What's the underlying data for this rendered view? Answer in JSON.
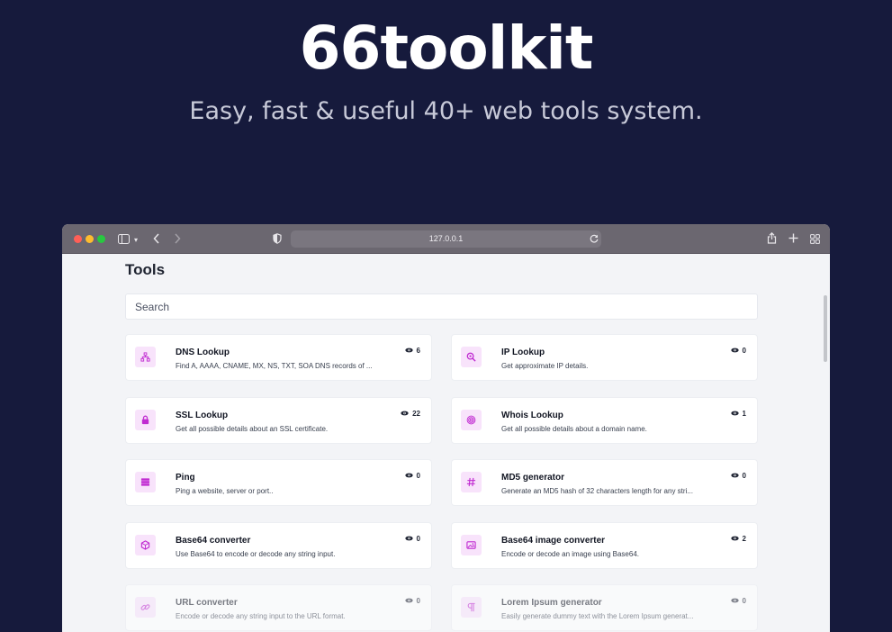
{
  "hero": {
    "title": "66toolkit",
    "subtitle": "Easy, fast & useful 40+ web tools system."
  },
  "browser": {
    "address": "127.0.0.1"
  },
  "page": {
    "title": "Tools",
    "search_placeholder": "Search"
  },
  "colors": {
    "background": "#161a3c",
    "accent": "#c02ad1",
    "icon_bg": "#f8e3fb"
  },
  "tools": [
    {
      "name": "DNS Lookup",
      "description": "Find A, AAAA, CNAME, MX, NS, TXT, SOA DNS records of ...",
      "views": "6",
      "icon": "network-icon"
    },
    {
      "name": "IP Lookup",
      "description": "Get approximate IP details.",
      "views": "0",
      "icon": "search-location-icon"
    },
    {
      "name": "SSL Lookup",
      "description": "Get all possible details about an SSL certificate.",
      "views": "22",
      "icon": "lock-icon"
    },
    {
      "name": "Whois Lookup",
      "description": "Get all possible details about a domain name.",
      "views": "1",
      "icon": "fingerprint-icon"
    },
    {
      "name": "Ping",
      "description": "Ping a website, server or port..",
      "views": "0",
      "icon": "server-icon"
    },
    {
      "name": "MD5 generator",
      "description": "Generate an MD5 hash of 32 characters length for any stri...",
      "views": "0",
      "icon": "hashtag-icon"
    },
    {
      "name": "Base64 converter",
      "description": "Use Base64 to encode or decode any string input.",
      "views": "0",
      "icon": "cube-icon"
    },
    {
      "name": "Base64 image converter",
      "description": "Encode or decode an image using Base64.",
      "views": "2",
      "icon": "image-icon"
    },
    {
      "name": "URL converter",
      "description": "Encode or decode any string input to the URL format.",
      "views": "0",
      "icon": "link-icon"
    },
    {
      "name": "Lorem Ipsum generator",
      "description": "Easily generate dummy text with the Lorem Ipsum generat...",
      "views": "0",
      "icon": "paragraph-icon"
    }
  ]
}
